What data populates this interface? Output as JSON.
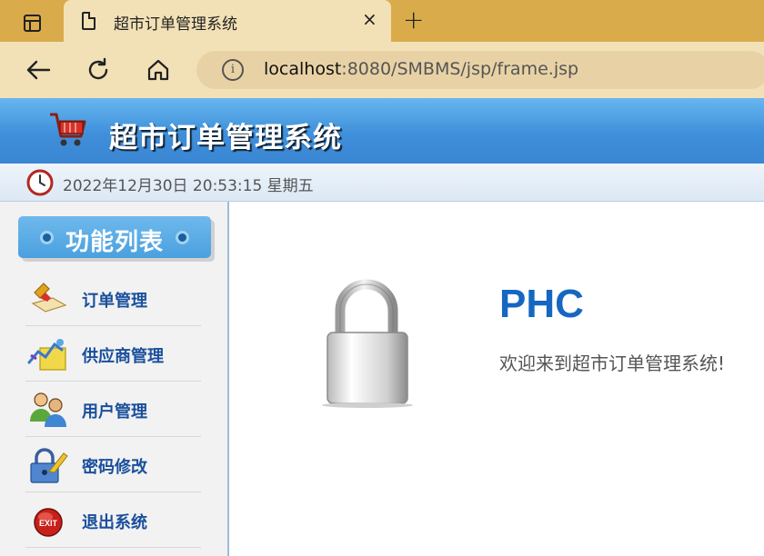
{
  "browser": {
    "tab": {
      "title": "超市订单管理系统",
      "close_glyph": "×",
      "icon": "document-icon"
    },
    "new_tab_glyph": "+",
    "url": {
      "host": "localhost",
      "rest": ":8080/SMBMS/jsp/frame.jsp"
    },
    "info_glyph": "i"
  },
  "header": {
    "title": "超市订单管理系统",
    "icon": "shopping-cart-icon"
  },
  "timebar": {
    "datetime": "2022年12月30日 20:53:15 星期五",
    "icon": "clock-icon"
  },
  "sidebar": {
    "heading": "功能列表",
    "items": [
      {
        "label": "订单管理",
        "icon": "order-icon"
      },
      {
        "label": "供应商管理",
        "icon": "supplier-icon"
      },
      {
        "label": "用户管理",
        "icon": "users-icon"
      },
      {
        "label": "密码修改",
        "icon": "lock-key-icon"
      },
      {
        "label": "退出系统",
        "icon": "exit-icon"
      }
    ]
  },
  "main": {
    "user": "PHC",
    "welcome": "欢迎来到超市订单管理系统!",
    "icon": "padlock-icon"
  },
  "colors": {
    "header_blue": "#3f8fdb",
    "menu_text": "#1a4f9c",
    "user_text": "#1667c1",
    "chrome": "#d9ab4a"
  }
}
